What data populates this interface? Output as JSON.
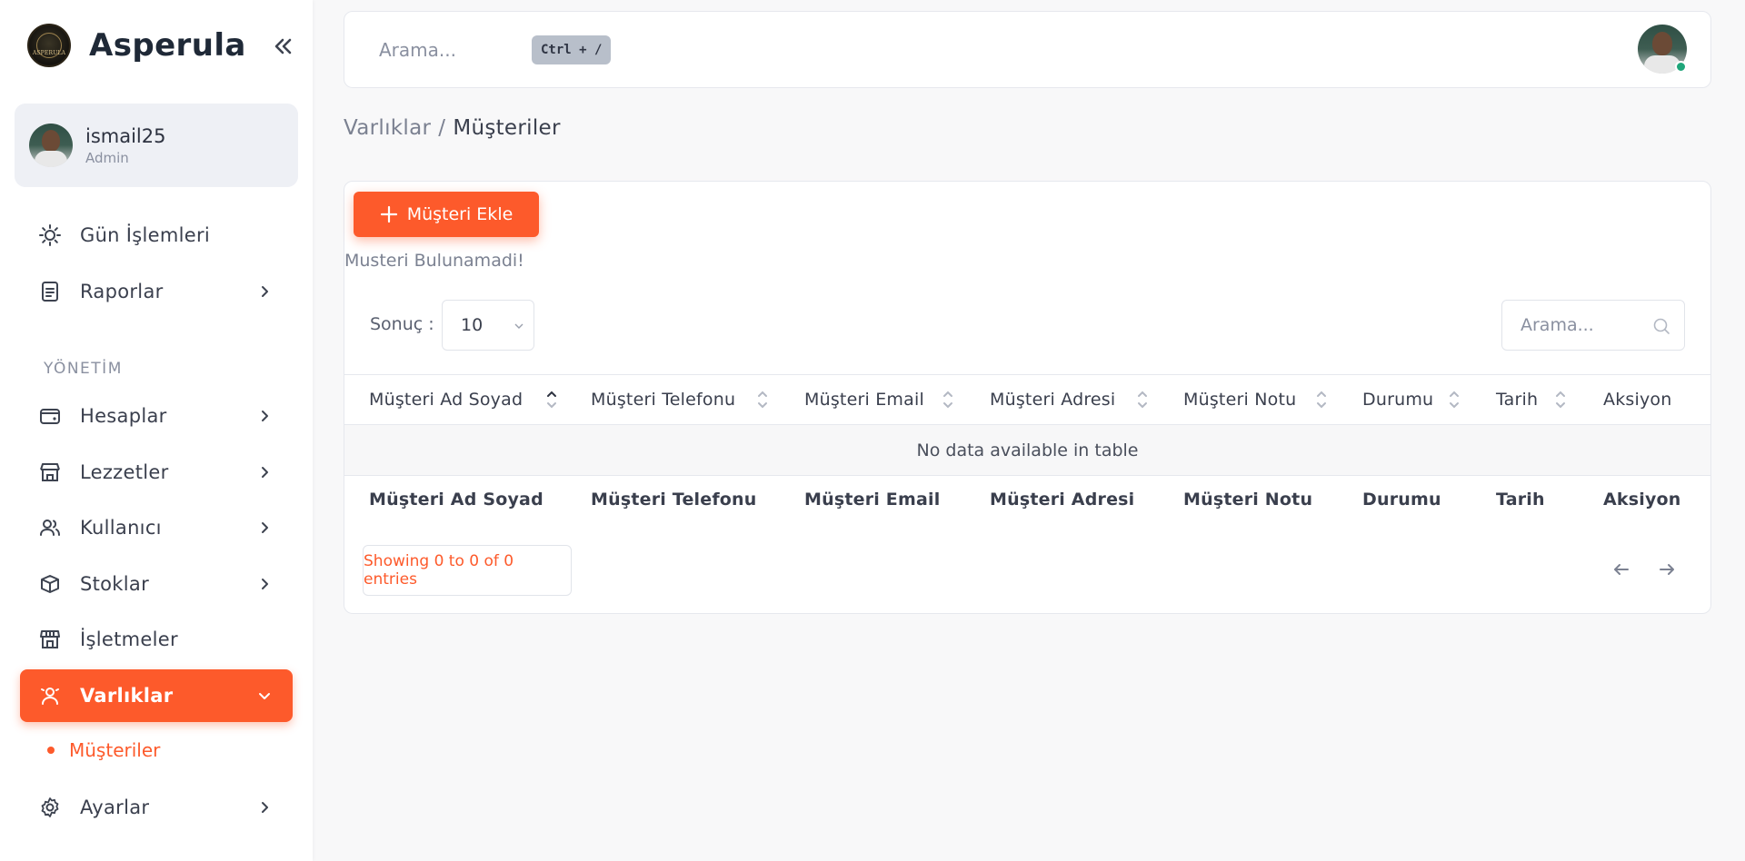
{
  "brand": {
    "name": "Asperula",
    "logo_text": "ASPERULA"
  },
  "user": {
    "name": "ismail25",
    "role": "Admin"
  },
  "nav": {
    "items": [
      {
        "label": "Gün İşlemleri"
      },
      {
        "label": "Raporlar"
      }
    ],
    "section_label": "YÖNETİM",
    "admin_items": [
      {
        "label": "Hesaplar"
      },
      {
        "label": "Lezzetler"
      },
      {
        "label": "Kullanıcı"
      },
      {
        "label": "Stoklar"
      },
      {
        "label": "İşletmeler"
      },
      {
        "label": "Varlıklar"
      }
    ],
    "sub_items": [
      {
        "label": "Müşteriler"
      }
    ],
    "settings": {
      "label": "Ayarlar"
    }
  },
  "topbar": {
    "search_placeholder": "Arama...",
    "shortcut": "Ctrl + /"
  },
  "breadcrumb": {
    "parent": "Varlıklar",
    "separator": "/",
    "current": "Müşteriler"
  },
  "content": {
    "add_button": "Müşteri Ekle",
    "empty_message": "Musteri Bulunamadi!",
    "length_label": "Sonuç :",
    "length_value": "10",
    "search_placeholder": "Arama...",
    "columns": [
      "Müşteri Ad Soyad",
      "Müşteri Telefonu",
      "Müşteri Email",
      "Müşteri Adresi",
      "Müşteri Notu",
      "Durumu",
      "Tarih",
      "Aksiyon"
    ],
    "no_data": "No data available in table",
    "info": "Showing 0 to 0 of 0 entries"
  },
  "colors": {
    "accent": "#fd5a2b",
    "online": "#1fa67a"
  }
}
